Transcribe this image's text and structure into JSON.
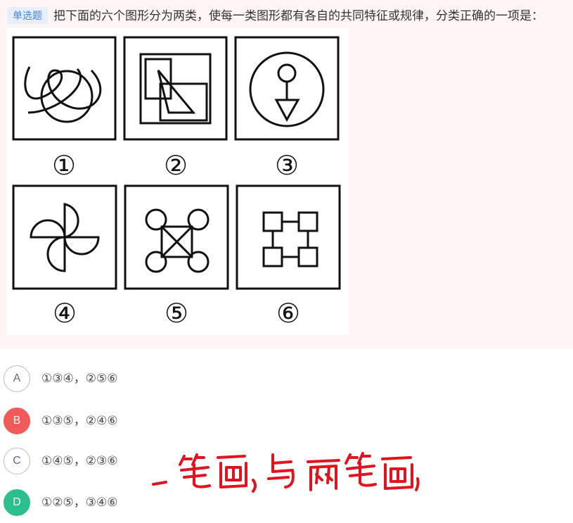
{
  "question": {
    "type_tag": "单选题",
    "text": "把下面的六个图形分为两类，使每一类图形都有各自的共同特征或规律，分类正确的一项是：",
    "figures": [
      {
        "number": "①"
      },
      {
        "number": "②"
      },
      {
        "number": "③"
      },
      {
        "number": "④"
      },
      {
        "number": "⑤"
      },
      {
        "number": "⑥"
      }
    ]
  },
  "options": [
    {
      "letter": "A",
      "text": "①③④，②⑤⑥",
      "state": "default"
    },
    {
      "letter": "B",
      "text": "①③⑤，②④⑥",
      "state": "wrong"
    },
    {
      "letter": "C",
      "text": "①④⑤，②③⑥",
      "state": "default"
    },
    {
      "letter": "D",
      "text": "①②⑤，③④⑥",
      "state": "correct"
    }
  ],
  "handwriting": {
    "text": "一笔画，与两笔画"
  },
  "colors": {
    "question_bg": "#fff5f5",
    "tag_bg": "#e7effc",
    "tag_text": "#4a82d9",
    "wrong": "#f25a5a",
    "correct": "#2bbf8f",
    "ink_red": "#e0141e"
  }
}
